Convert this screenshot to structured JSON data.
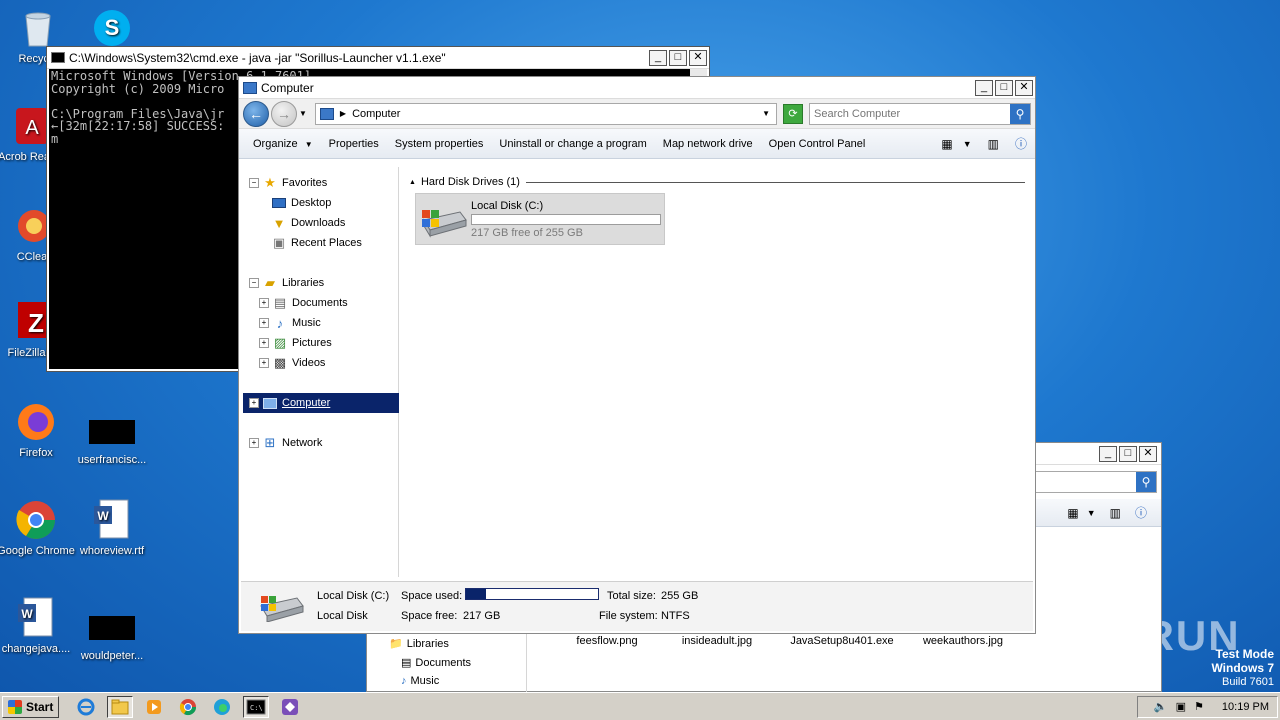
{
  "desktop": {
    "icons": [
      {
        "label": "Recycle",
        "icon": "recycle-bin-icon"
      },
      {
        "label": "",
        "icon": "skype-icon"
      },
      {
        "label": "Acrob Reader",
        "icon": "acrobat-reader-icon"
      },
      {
        "label": "CClea",
        "icon": "ccleaner-icon"
      },
      {
        "label": "FileZilla C",
        "icon": "filezilla-icon"
      },
      {
        "label": "Firefox",
        "icon": "firefox-icon"
      },
      {
        "label": "userfrancisc...",
        "icon": "black-file-icon"
      },
      {
        "label": "Google Chrome",
        "icon": "chrome-icon"
      },
      {
        "label": "whoreview.rtf",
        "icon": "word-document-icon"
      },
      {
        "label": "changejava....",
        "icon": "word-document-icon"
      },
      {
        "label": "wouldpeter...",
        "icon": "black-file-icon"
      }
    ],
    "watermark": {
      "line1": "Test Mode",
      "line2": "Windows 7",
      "line3": "Build 7601"
    },
    "brand": "ANY RUN"
  },
  "cmd_window": {
    "title": "C:\\Windows\\System32\\cmd.exe - java  -jar \"Sorillus-Launcher v1.1.exe\"",
    "console_lines": [
      "Microsoft Windows [Version 6.1.7601]",
      "Copyright (c) 2009 Micro",
      "",
      "C:\\Program Files\\Java\\jr",
      "←[32m[22:17:58] SUCCESS:",
      "m"
    ]
  },
  "explorer": {
    "title": "Computer",
    "address": "Computer",
    "search_placeholder": "Search Computer",
    "commands": [
      "Organize",
      "Properties",
      "System properties",
      "Uninstall or change a program",
      "Map network drive",
      "Open Control Panel"
    ],
    "nav": {
      "favorites": "Favorites",
      "desktop": "Desktop",
      "downloads": "Downloads",
      "recent": "Recent Places",
      "libraries": "Libraries",
      "documents": "Documents",
      "music": "Music",
      "pictures": "Pictures",
      "videos": "Videos",
      "computer": "Computer",
      "network": "Network"
    },
    "group_header": "Hard Disk Drives (1)",
    "drive": {
      "name": "Local Disk (C:)",
      "free_text": "217 GB free of 255 GB",
      "used_fraction": 0.149
    },
    "details": {
      "name": "Local Disk (C:)",
      "type": "Local Disk",
      "space_used_label": "Space used:",
      "space_free_label": "Space free:",
      "space_free_value": "217 GB",
      "total_size_label": "Total size:",
      "total_size_value": "255 GB",
      "fs_label": "File system:",
      "fs_value": "NTFS"
    }
  },
  "explorer2": {
    "nav_libraries": "Libraries",
    "nav_documents": "Documents",
    "nav_music": "Music",
    "files": [
      "feesflow.png",
      "insideadult.jpg",
      "JavaSetup8u401.exe",
      "weekauthors.jpg"
    ]
  },
  "taskbar": {
    "start": "Start",
    "clock": "10:19 PM"
  },
  "colors": {
    "selection": "#0a246a",
    "taskbar": "#d4d0c8"
  }
}
